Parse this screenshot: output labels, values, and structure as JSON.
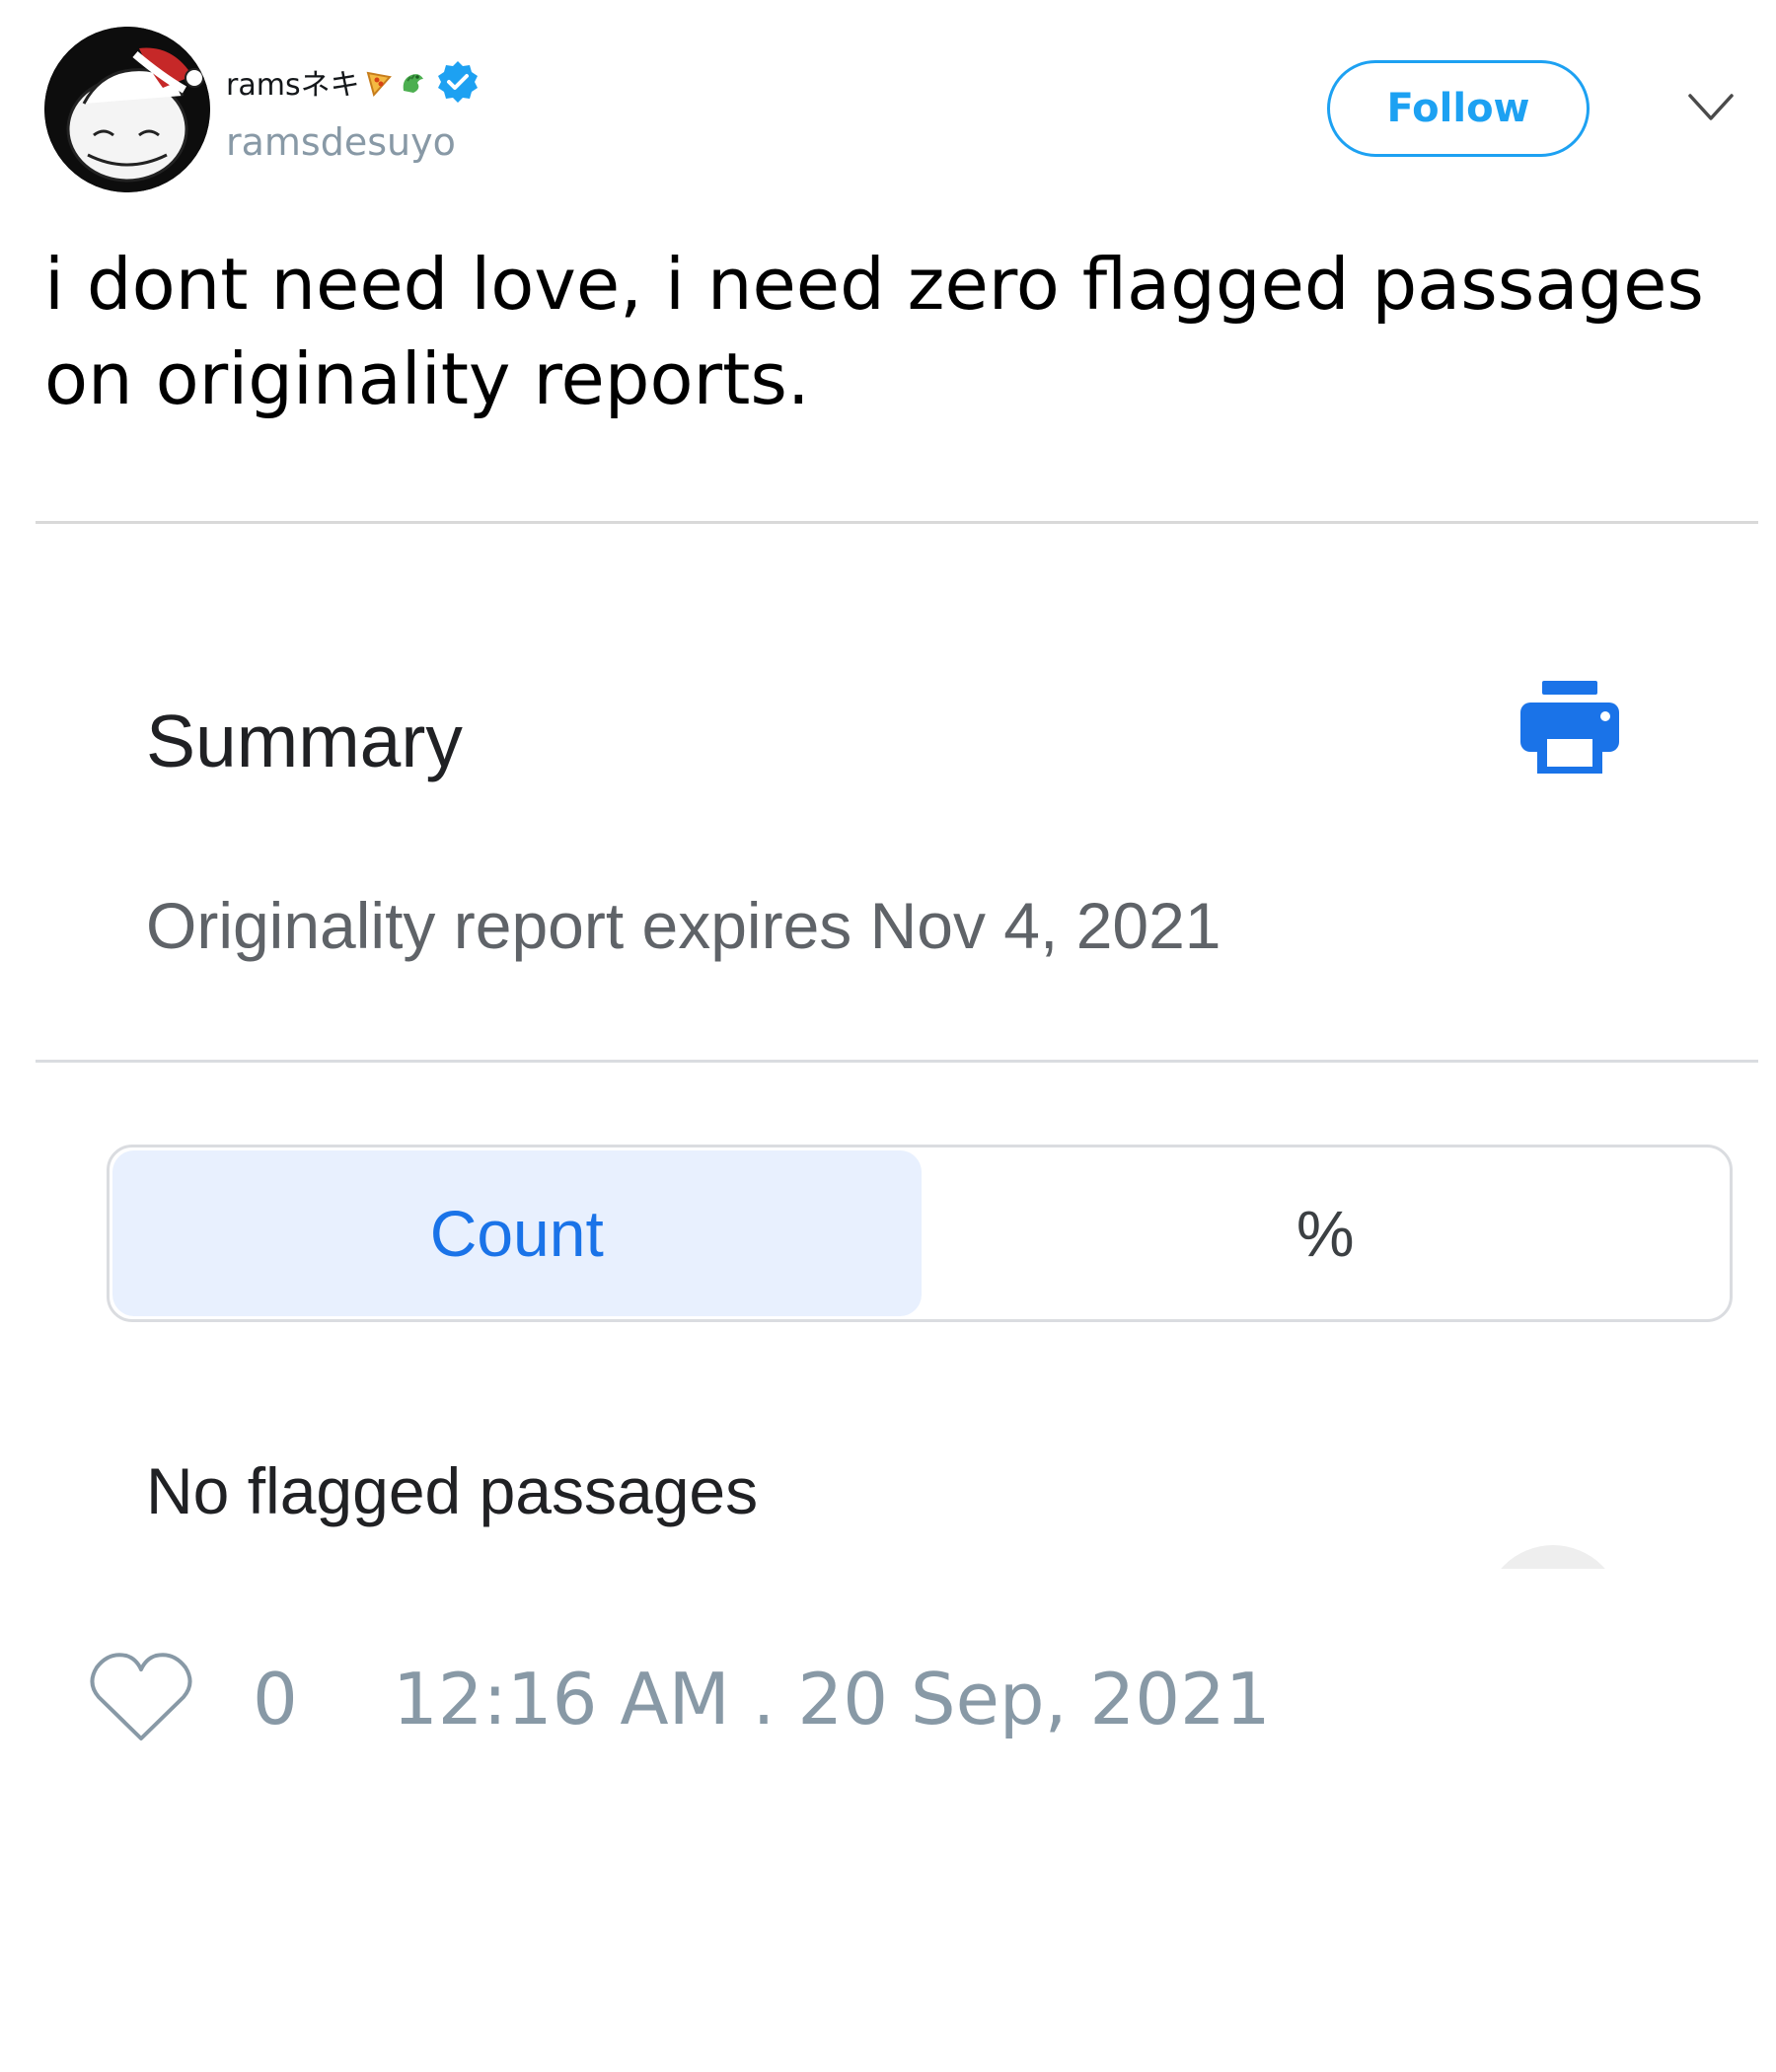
{
  "header": {
    "display_name": "ramsネキ",
    "handle": "ramsdesuyo",
    "follow_label": "Follow",
    "emojis": [
      "pizza-emoji",
      "dragon-emoji"
    ],
    "verified": true
  },
  "tweet": {
    "text": "i dont need love, i need zero flagged passages on originality reports."
  },
  "media": {
    "summary_title": "Summary",
    "expires_text": "Originality report expires Nov 4, 2021",
    "toggle": {
      "count_label": "Count",
      "percent_label": "%",
      "selected": "Count"
    },
    "no_flagged_text": "No flagged passages"
  },
  "footer": {
    "like_count": "0",
    "timestamp": "12:16 AM . 20 Sep, 2021"
  },
  "colors": {
    "twitter_blue": "#1da1f2",
    "muted_gray": "#8899a6",
    "google_blue": "#1a73e8",
    "toggle_active_bg": "#e8f0fe"
  }
}
